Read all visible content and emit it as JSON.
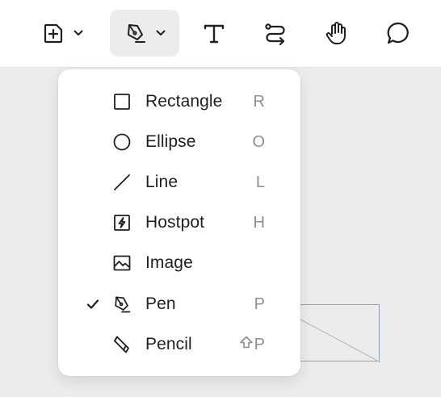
{
  "toolbar": {
    "tools": [
      {
        "name": "insert-frame",
        "icon": "plus-square-icon",
        "has_dropdown": true
      },
      {
        "name": "shapes",
        "icon": "pen-icon",
        "has_dropdown": true,
        "active": true
      },
      {
        "name": "text",
        "icon": "text-icon"
      },
      {
        "name": "connector",
        "icon": "connector-icon"
      },
      {
        "name": "hand",
        "icon": "hand-icon"
      },
      {
        "name": "comment",
        "icon": "comment-icon"
      }
    ]
  },
  "menu": {
    "items": [
      {
        "label": "Rectangle",
        "shortcut": "R",
        "icon": "square-icon",
        "checked": false
      },
      {
        "label": "Ellipse",
        "shortcut": "O",
        "icon": "circle-icon",
        "checked": false
      },
      {
        "label": "Line",
        "shortcut": "L",
        "icon": "line-icon",
        "checked": false
      },
      {
        "label": "Hostpot",
        "shortcut": "H",
        "icon": "hotspot-icon",
        "checked": false
      },
      {
        "label": "Image",
        "shortcut": "",
        "icon": "image-icon",
        "checked": false
      },
      {
        "label": "Pen",
        "shortcut": "P",
        "icon": "pen-icon",
        "checked": true
      },
      {
        "label": "Pencil",
        "shortcut": "P",
        "shortcut_modifier": "shift",
        "icon": "pencil-icon",
        "checked": false
      }
    ]
  },
  "colors": {
    "canvas": "#ececed",
    "selection": "#7ea2f0",
    "text": "#1f1f22",
    "shortcut": "#8e8e93"
  }
}
